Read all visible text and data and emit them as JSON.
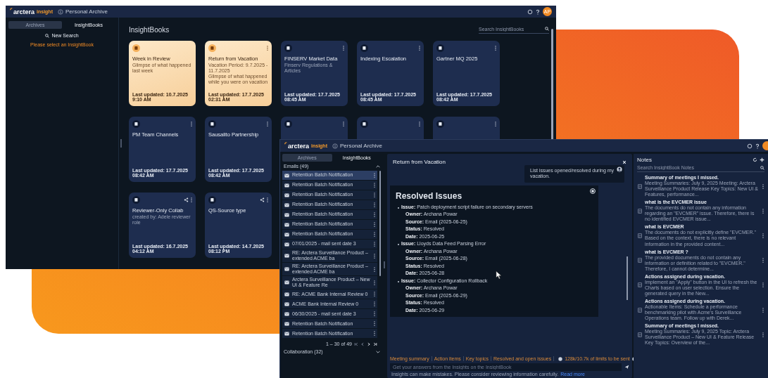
{
  "back_window": {
    "brand": "arctera",
    "product": "insight",
    "title": "Personal Archive",
    "avatar": "AP",
    "tabs": [
      {
        "label": "Archives",
        "selected": false
      },
      {
        "label": "InsightBooks",
        "selected": true
      }
    ],
    "new_search": "New Search",
    "empty_message": "Please select an InsightBook",
    "heading": "InsightBooks",
    "search": {
      "placeholder": "Search InsightBooks"
    },
    "cards": [
      {
        "title": "Week in Review",
        "subtitle": "Glimpse of what happened last week",
        "updated": "Last updated: 10.7.2025 9:10 AM",
        "highlighted": true,
        "menu": false,
        "shared": false
      },
      {
        "title": "Return from Vacation",
        "subtitle": "Vacation Period: 9.7.2025 - 11.7.2025",
        "description": "Glimpse of what happened while you were on vacation",
        "updated": "Last updated: 17.7.2025 02:31 AM",
        "highlighted": true,
        "menu": true,
        "shared": false
      },
      {
        "title": "FINSERV Market Data",
        "subtitle": "Finserv Regulations & Articles",
        "updated": "Last updated: 17.7.2025 08:45 AM",
        "highlighted": false,
        "menu": true,
        "shared": false
      },
      {
        "title": "Indexing Escalation",
        "updated": "Last updated: 17.7.2025 08:45 AM",
        "highlighted": false,
        "menu": true,
        "shared": false
      },
      {
        "title": "Gartner MQ 2025",
        "updated": "Last updated: 17.7.2025 08:42 AM",
        "highlighted": false,
        "menu": true,
        "shared": false
      },
      {
        "title": "PM Team Channels",
        "updated": "Last updated: 17.7.2025 08:42 AM",
        "highlighted": false,
        "menu": true,
        "shared": false
      },
      {
        "title": "Sausalito Partnership",
        "updated": "Last updated: 17.7.2025 08:42 AM",
        "highlighted": false,
        "menu": true,
        "shared": false
      },
      {
        "highlighted": false,
        "menu": true,
        "shared": false
      },
      {
        "highlighted": false,
        "menu": true,
        "shared": false
      },
      {
        "highlighted": false,
        "menu": true,
        "shared": false
      },
      {
        "title": "Reviewer-Only Collab",
        "subtitle": "created by: Adele reviewer role",
        "updated": "Last updated: 16.7.2025 04:12 AM",
        "highlighted": false,
        "menu": true,
        "shared": true
      },
      {
        "title": "QS-Source type",
        "updated": "Last updated: 14.7.2025 08:12 PM",
        "highlighted": false,
        "menu": true,
        "shared": true
      }
    ]
  },
  "front_window": {
    "brand": "arctera",
    "product": "insight",
    "title": "Personal Archive",
    "tabs": [
      {
        "label": "Archives",
        "selected": false
      },
      {
        "label": "InsightBooks",
        "selected": true
      }
    ],
    "emails": {
      "header": "Emails (49)",
      "expanded": true,
      "items": [
        {
          "subject": "Retention Batch Notification",
          "selected": true
        },
        {
          "subject": "Retention Batch Notification",
          "selected": false
        },
        {
          "subject": "Retention Batch Notification",
          "selected": false
        },
        {
          "subject": "Retention Batch Notification",
          "selected": false
        },
        {
          "subject": "Retention Batch Notification",
          "selected": false
        },
        {
          "subject": "Retention Batch Notification",
          "selected": false
        },
        {
          "subject": "Retention Batch Notification",
          "selected": false
        },
        {
          "subject": "07/01/2025 - mail sent date 3",
          "selected": false
        },
        {
          "subject": "RE: Arctera Surveillance Product – extended ACME ba",
          "selected": false
        },
        {
          "subject": "RE: Arctera Surveillance Product – extended ACME ba",
          "selected": false
        },
        {
          "subject": "Arctera Surveillance Product – New UI & Feature Re",
          "selected": false
        },
        {
          "subject": "RE: ACME Bank Internal Review 0",
          "selected": false
        },
        {
          "subject": "ACME Bank Internal Review 0",
          "selected": false
        },
        {
          "subject": "06/30/2025 - mail sent date 3",
          "selected": false
        },
        {
          "subject": "Retention Batch Notification",
          "selected": false
        },
        {
          "subject": "Retention Batch Notification",
          "selected": false
        }
      ],
      "pagination": "1 – 30 of 49"
    },
    "collaboration": {
      "header": "Collaboration (32)",
      "expanded": false
    },
    "chat": {
      "title": "Return from Vacation",
      "user_message": "List issues opened/resolved during my vacation.",
      "answer": {
        "heading": "Resolved Issues",
        "issues": [
          {
            "issue": "**Issue:** Patch deployment script failure on secondary servers",
            "fields": [
              "**Owner:** Archana Powar",
              "**Source:** Email (2025-06-25)",
              "**Status:** Resolved",
              "**Date:** 2025-06-25"
            ]
          },
          {
            "issue": "**Issue:** Lloyds Data Feed Parsing Error",
            "fields": [
              "**Owner:** Archana Powar",
              "**Source:** Email (2025-06-28)",
              "**Status:** Resolved",
              "**Date:** 2025-06-28"
            ]
          },
          {
            "issue": "**Issue:** Collector Configuration Rollback",
            "fields": [
              "**Owner:** Archana Powar",
              "**Source:** Email (2025-06-29)",
              "**Status:** Resolved",
              "**Date:** 2025-06-29"
            ]
          }
        ]
      },
      "quick_actions": [
        "Meeting summary",
        "Action items",
        "Key topics",
        "Resolved and open issues"
      ],
      "token_info": "128k/10.7k of limits to be sent",
      "input": {
        "placeholder": "Get your answers from the Insights on the InsightBook"
      },
      "disclaimer": "Insights can make mistakes. Please consider reviewing information carefully.",
      "disclaimer_link": "Read more"
    },
    "notes": {
      "title": "Notes",
      "search": {
        "placeholder": "Search InsightBook Notes"
      },
      "items": [
        {
          "title": "Summary of meetings I missed.",
          "preview": "Meeting Summaries: July 9, 2025 Meeting: Arctera Surveillance Product Release Key Topics: New UI & Features, performance..."
        },
        {
          "title": "what is the EVCMER issue",
          "preview": "The documents do not contain any information regarding an \"EVCMER\" issue. Therefore, there is no identified EVCMER issue..."
        },
        {
          "title": "what is EVCMER",
          "preview": "The documents do not explicitly define \"EVCMER.\" Based on the context, there is no relevant information in the provided content..."
        },
        {
          "title": "what is EVCMER ?",
          "preview": "The provided documents do not contain any information or definition related to \"EVCMER.\" Therefore, I cannot determine..."
        },
        {
          "title": "Actions assigned during vacation.",
          "preview": "Implement an \"Apply\" button in the UI to refresh the Charts based on user selection. Ensure the generated query in the New..."
        },
        {
          "title": "Actions assigned during vacation.",
          "preview": "Actionable Items: Schedule a performance benchmarking pilot with Acme's Surveillance Operations team. Follow up with Derek..."
        },
        {
          "title": "Summary of meetings I missed.",
          "preview": "Meeting Summaries: July 9, 2025 Topic: Arctera Surveillance Product – New UI & Feature Release Key Topics: Overview of the..."
        }
      ]
    }
  }
}
